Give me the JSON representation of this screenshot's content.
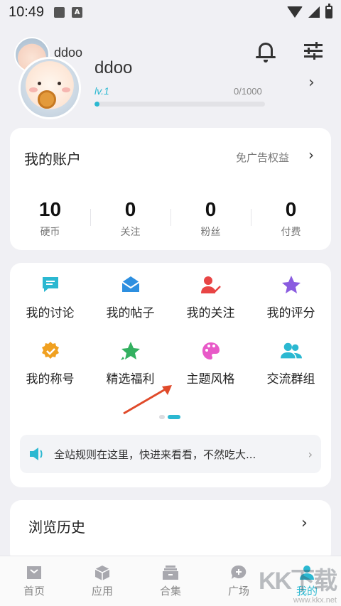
{
  "status_bar": {
    "time": "10:49",
    "a_icon_letter": "A"
  },
  "profile": {
    "small_name": "ddoo",
    "name": "ddoo",
    "level": "lv.1",
    "exp_text": "0/1000",
    "exp_progress": 0.03
  },
  "account": {
    "title": "我的账户",
    "benefit": "免广告权益",
    "stats": [
      {
        "value": "10",
        "label": "硬币"
      },
      {
        "value": "0",
        "label": "关注"
      },
      {
        "value": "0",
        "label": "粉丝"
      },
      {
        "value": "0",
        "label": "付费"
      }
    ]
  },
  "menu": {
    "items": [
      {
        "label": "我的讨论",
        "icon": "discussion-icon",
        "color": "#2bb8d1"
      },
      {
        "label": "我的帖子",
        "icon": "envelope-icon",
        "color": "#2d8fe0"
      },
      {
        "label": "我的关注",
        "icon": "follow-user-icon",
        "color": "#e84545"
      },
      {
        "label": "我的评分",
        "icon": "star-icon",
        "color": "#8a5ce0"
      },
      {
        "label": "我的称号",
        "icon": "badge-icon",
        "color": "#f0a020"
      },
      {
        "label": "精选福利",
        "icon": "star-gift-icon",
        "color": "#33b060"
      },
      {
        "label": "主题风格",
        "icon": "palette-icon",
        "color": "#e85ac8"
      },
      {
        "label": "交流群组",
        "icon": "group-icon",
        "color": "#2bb8d1"
      }
    ],
    "page_count": 2,
    "active_page": 2
  },
  "notice": {
    "text": "全站规则在这里，快进来看看，不然吃大..."
  },
  "history": {
    "title": "浏览历史"
  },
  "tabbar": {
    "tabs": [
      {
        "label": "首页",
        "icon": "home-icon"
      },
      {
        "label": "应用",
        "icon": "apps-icon"
      },
      {
        "label": "合集",
        "icon": "collection-icon"
      },
      {
        "label": "广场",
        "icon": "square-icon"
      },
      {
        "label": "我的",
        "icon": "profile-icon"
      }
    ],
    "active": "我的"
  },
  "watermark": {
    "big": "KK下载",
    "url": "www.kkx.net"
  },
  "colors": {
    "accent": "#2bb8d1",
    "annotation_arrow": "#e04a2a"
  }
}
